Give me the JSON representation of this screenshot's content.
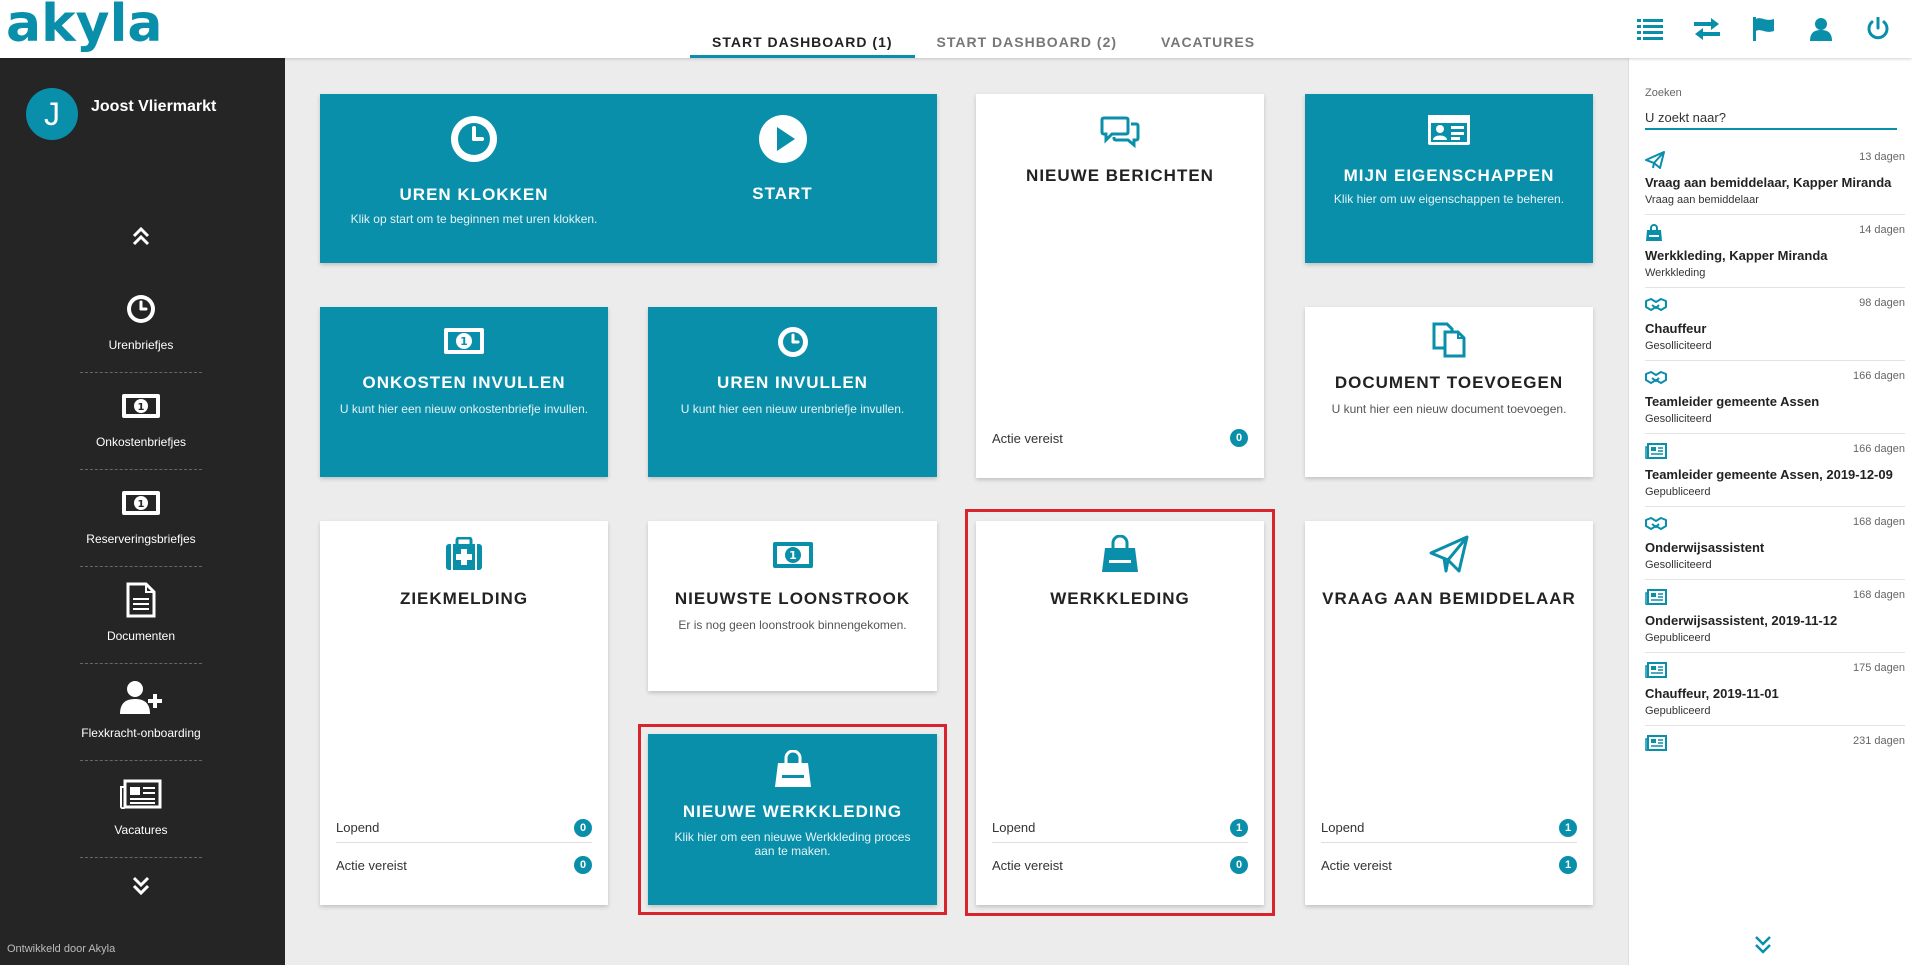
{
  "brand": {
    "logo_text": "akyla",
    "accent": "#0a8fab",
    "highlight": "#d9232d"
  },
  "tabs": [
    {
      "label": "START DASHBOARD (1)",
      "active": true
    },
    {
      "label": "START DASHBOARD (2)",
      "active": false
    },
    {
      "label": "VACATURES",
      "active": false
    }
  ],
  "top_icons": [
    "list-icon",
    "swap-arrows-icon",
    "flag-icon",
    "user-icon",
    "power-icon"
  ],
  "sidebar": {
    "avatar_letter": "J",
    "user_name": "Joost Vliermarkt",
    "items": [
      {
        "label": "Urenbriefjes",
        "icon": "clock-icon"
      },
      {
        "label": "Onkostenbriefjes",
        "icon": "money-icon"
      },
      {
        "label": "Reserveringsbriefjes",
        "icon": "money-icon"
      },
      {
        "label": "Documenten",
        "icon": "document-icon"
      },
      {
        "label": "Flexkracht-onboarding",
        "icon": "user-plus-icon"
      },
      {
        "label": "Vacatures",
        "icon": "newspaper-icon"
      }
    ],
    "footer": "Ontwikkeld door Akyla"
  },
  "tiles": {
    "uren_klokken": {
      "title": "UREN KLOKKEN",
      "desc": "Klik op start om te beginnen met uren klokken.",
      "start_label": "START"
    },
    "nieuwe_berichten": {
      "title": "NIEUWE BERICHTEN",
      "row1_label": "Actie vereist",
      "row1_count": "0"
    },
    "mijn_eigenschappen": {
      "title": "MIJN EIGENSCHAPPEN",
      "desc": "Klik hier om uw eigenschappen te beheren."
    },
    "onkosten_invullen": {
      "title": "ONKOSTEN INVULLEN",
      "desc": "U kunt hier een nieuw onkostenbriefje invullen."
    },
    "uren_invullen": {
      "title": "UREN INVULLEN",
      "desc": "U kunt hier een nieuw urenbriefje invullen."
    },
    "document_toevoegen": {
      "title": "DOCUMENT TOEVOEGEN",
      "desc": "U kunt hier een nieuw document toevoegen."
    },
    "ziekmelding": {
      "title": "ZIEKMELDING",
      "row1_label": "Lopend",
      "row1_count": "0",
      "row2_label": "Actie vereist",
      "row2_count": "0"
    },
    "nieuwste_loonstrook": {
      "title": "NIEUWSTE LOONSTROOK",
      "desc": "Er is nog geen loonstrook binnengekomen."
    },
    "werkkleding": {
      "title": "WERKKLEDING",
      "row1_label": "Lopend",
      "row1_count": "1",
      "row2_label": "Actie vereist",
      "row2_count": "0"
    },
    "vraag_bemiddelaar": {
      "title": "VRAAG AAN BEMIDDELAAR",
      "row1_label": "Lopend",
      "row1_count": "1",
      "row2_label": "Actie vereist",
      "row2_count": "1"
    },
    "nieuwe_werkkleding": {
      "title": "NIEUWE WERKKLEDING",
      "desc": "Klik hier om een nieuwe Werkkleding proces aan te maken."
    }
  },
  "search": {
    "label": "Zoeken",
    "placeholder": "U zoekt naar?"
  },
  "feed": [
    {
      "icon": "paper-plane-icon",
      "days": "13 dagen",
      "title": "Vraag aan bemiddelaar, Kapper Miranda",
      "sub": "Vraag aan bemiddelaar"
    },
    {
      "icon": "shopping-bag-icon",
      "days": "14 dagen",
      "title": "Werkkleding, Kapper Miranda",
      "sub": "Werkkleding"
    },
    {
      "icon": "handshake-icon",
      "days": "98 dagen",
      "title": "Chauffeur",
      "sub": "Gesolliciteerd"
    },
    {
      "icon": "handshake-icon",
      "days": "166 dagen",
      "title": "Teamleider gemeente Assen",
      "sub": "Gesolliciteerd"
    },
    {
      "icon": "newspaper-icon",
      "days": "166 dagen",
      "title": "Teamleider gemeente Assen, 2019-12-09",
      "sub": "Gepubliceerd"
    },
    {
      "icon": "handshake-icon",
      "days": "168 dagen",
      "title": "Onderwijsassistent",
      "sub": "Gesolliciteerd"
    },
    {
      "icon": "newspaper-icon",
      "days": "168 dagen",
      "title": "Onderwijsassistent, 2019-11-12",
      "sub": "Gepubliceerd"
    },
    {
      "icon": "newspaper-icon",
      "days": "175 dagen",
      "title": "Chauffeur, 2019-11-01",
      "sub": "Gepubliceerd"
    },
    {
      "icon": "newspaper-icon",
      "days": "231 dagen",
      "title": "",
      "sub": ""
    }
  ]
}
